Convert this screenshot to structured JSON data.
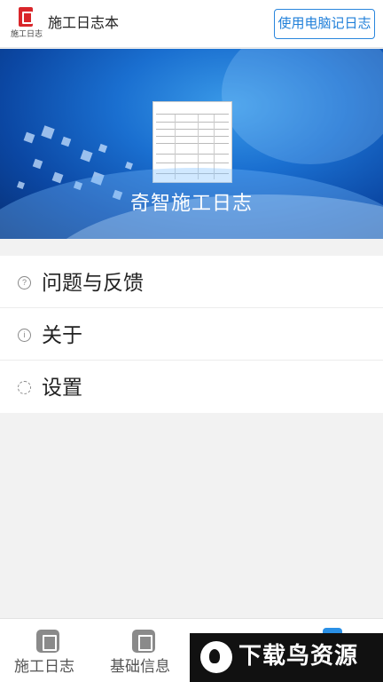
{
  "header": {
    "logo_text": "施工日志",
    "title": "施工日志本",
    "pc_button_label": "使用电脑记日志"
  },
  "banner": {
    "title": "奇智施工日志"
  },
  "menu": {
    "items": [
      {
        "label": "问题与反馈",
        "icon": "question-icon"
      },
      {
        "label": "关于",
        "icon": "info-icon"
      },
      {
        "label": "设置",
        "icon": "gear-icon"
      }
    ]
  },
  "bottom_nav": {
    "items": [
      {
        "label": "施工日志",
        "icon": "log-icon"
      },
      {
        "label": "基础信息",
        "icon": "books-icon"
      }
    ]
  },
  "watermark": {
    "text": "下载鸟资源"
  },
  "colors": {
    "accent": "#2a86dd",
    "logo_red": "#d9262a",
    "banner_blue": "#1a6fd0"
  }
}
